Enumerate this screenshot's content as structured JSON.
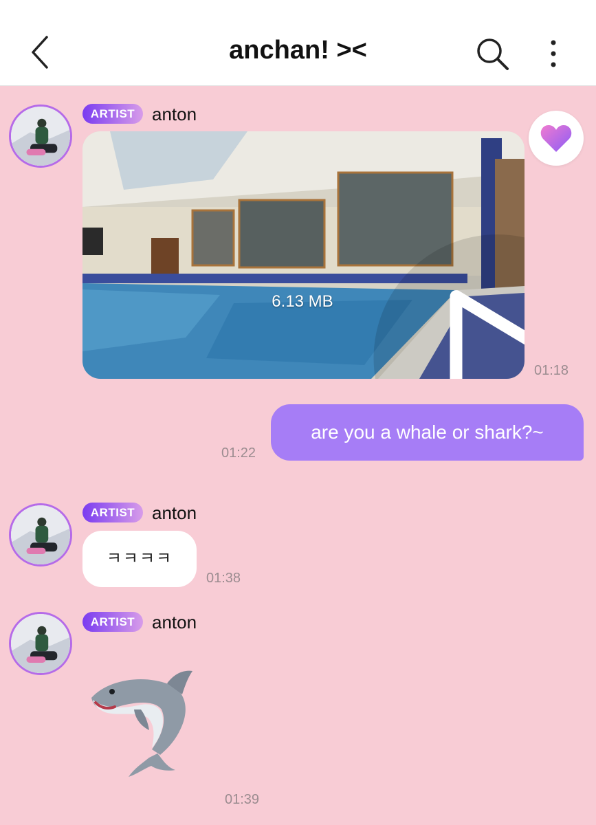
{
  "header": {
    "title": "anchan! ><",
    "back_icon": "chevron-left-icon",
    "search_icon": "search-icon",
    "more_icon": "more-vertical-icon"
  },
  "messages": [
    {
      "sender": "anton",
      "badge": "ARTIST",
      "type": "video",
      "file_size": "6.13 MB",
      "time": "01:18"
    },
    {
      "from_me": true,
      "type": "text",
      "text": "are you a whale or shark?~",
      "time": "01:22"
    },
    {
      "sender": "anton",
      "badge": "ARTIST",
      "type": "text",
      "text": "ㅋㅋㅋㅋ",
      "time": "01:38"
    },
    {
      "sender": "anton",
      "badge": "ARTIST",
      "type": "sticker",
      "sticker_icon": "shark-emoji-icon",
      "time": "01:39"
    }
  ],
  "colors": {
    "background": "#f8ccd5",
    "outgoing_bubble": "#a67df6",
    "badge_start": "#7a3cf0",
    "badge_end": "#d79ce9",
    "avatar_ring": "#b56be8"
  }
}
